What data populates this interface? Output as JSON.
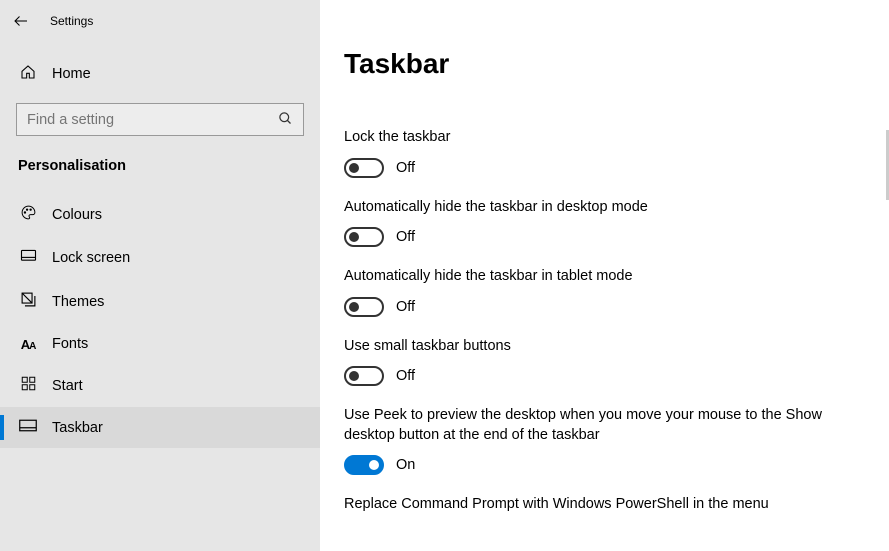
{
  "app_title": "Settings",
  "sidebar": {
    "home_label": "Home",
    "search_placeholder": "Find a setting",
    "category_label": "Personalisation",
    "items": [
      {
        "label": "Colours"
      },
      {
        "label": "Lock screen"
      },
      {
        "label": "Themes"
      },
      {
        "label": "Fonts"
      },
      {
        "label": "Start"
      },
      {
        "label": "Taskbar"
      }
    ]
  },
  "page": {
    "title": "Taskbar",
    "settings": [
      {
        "label": "Lock the taskbar",
        "on": false,
        "state_text": "Off"
      },
      {
        "label": "Automatically hide the taskbar in desktop mode",
        "on": false,
        "state_text": "Off"
      },
      {
        "label": "Automatically hide the taskbar in tablet mode",
        "on": false,
        "state_text": "Off"
      },
      {
        "label": "Use small taskbar buttons",
        "on": false,
        "state_text": "Off"
      },
      {
        "label": "Use Peek to preview the desktop when you move your mouse to the Show desktop button at the end of the taskbar",
        "on": true,
        "state_text": "On"
      }
    ],
    "partial_next_label": "Replace Command Prompt with Windows PowerShell in the menu"
  }
}
